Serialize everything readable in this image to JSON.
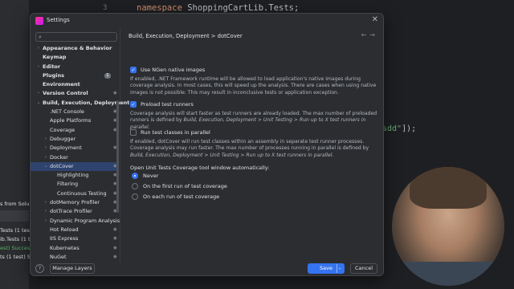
{
  "editor": {
    "line_number": "3",
    "code_keyword": "namespace",
    "code_rest": " ShoppingCartLib.Tests;",
    "fragment_string": "sdd\"",
    "fragment_tail": "]);"
  },
  "left_panel": {
    "rows": [
      "s from Solutio",
      "Tests (1 test",
      "ib.Tests (1 t",
      "est) Success",
      "ts (1 test) Su"
    ]
  },
  "dialog": {
    "title": "Settings",
    "close_glyph": "✕",
    "search_placeholder": ""
  },
  "sidebar": {
    "items": [
      {
        "label": "Appearance & Behavior",
        "bold": true,
        "arrow": "›"
      },
      {
        "label": "Keymap",
        "bold": true
      },
      {
        "label": "Editor",
        "bold": true,
        "arrow": "›"
      },
      {
        "label": "Plugins",
        "bold": true,
        "badge": "1"
      },
      {
        "label": "Environment",
        "bold": true
      },
      {
        "label": "Version Control",
        "bold": true,
        "arrow": "›",
        "gear": true
      },
      {
        "label": "Build, Execution, Deployment",
        "bold": true,
        "arrow": "⌄"
      },
      {
        "label": ".NET Console",
        "gear": true
      },
      {
        "label": "Apple Platforms",
        "gear": true
      },
      {
        "label": "Coverage",
        "gear": true
      },
      {
        "label": "Debugger",
        "arrow": "›"
      },
      {
        "label": "Deployment",
        "arrow": "›",
        "gear": true
      },
      {
        "label": "Docker",
        "arrow": "›"
      },
      {
        "label": "dotCover",
        "arrow": "⌄",
        "gear": true,
        "selected": true
      },
      {
        "label": "Highlighting",
        "gear": true
      },
      {
        "label": "Filtering",
        "gear": true
      },
      {
        "label": "Continuous Testing",
        "gear": true
      },
      {
        "label": "dotMemory Profiler",
        "arrow": "›",
        "gear": true
      },
      {
        "label": "dotTrace Profiler",
        "arrow": "›",
        "gear": true
      },
      {
        "label": "Dynamic Program Analysis",
        "arrow": "›"
      },
      {
        "label": "Hot Reload",
        "gear": true
      },
      {
        "label": "IIS Express",
        "gear": true
      },
      {
        "label": "Kubernetes",
        "gear": true
      },
      {
        "label": "NuGet",
        "gear": true
      }
    ]
  },
  "content": {
    "breadcrumb": "Build, Execution, Deployment  >  dotCover",
    "nav_arrows": "←→",
    "options": [
      {
        "label": "Use NGen native images",
        "checked": true,
        "desc": "If enabled, .NET Framework runtime will be allowed to load application's native images during coverage analysis. In most cases, this will speed up the analysis. There are cases when using native images is not possible: This may result in inconclusive tests or application exception."
      },
      {
        "label": "Preload test runners",
        "checked": true,
        "desc_plain": "Coverage analysis will start faster as test runners are already loaded. The max number of preloaded runners is defined by ",
        "desc_italic": "Build, Execution, Deployment > Unit Testing > Run up to X test runners in parallel."
      },
      {
        "label": "Run test classes in parallel",
        "checked": false,
        "desc_plain": "If enabled, dotCover will run test classes within an assembly in separate test runner processes. Coverage analysis may run faster. The max number of processes running in parallel is defined by ",
        "desc_italic": "Build, Execution, Deployment > Unit Testing > Run up to X test runners in parallel."
      }
    ],
    "radio_title": "Open Unit Tests Coverage tool window automatically:",
    "radios": [
      {
        "label": "Never",
        "selected": true
      },
      {
        "label": "On the first run of test coverage",
        "selected": false
      },
      {
        "label": "On each run of test coverage",
        "selected": false
      }
    ]
  },
  "footer": {
    "help": "?",
    "manage_layers": "Manage Layers",
    "save": "Save",
    "cancel": "Cancel"
  },
  "colors": {
    "accent": "#3574f0",
    "selection": "#2e436e",
    "dialog_bg": "#2b2d30"
  }
}
